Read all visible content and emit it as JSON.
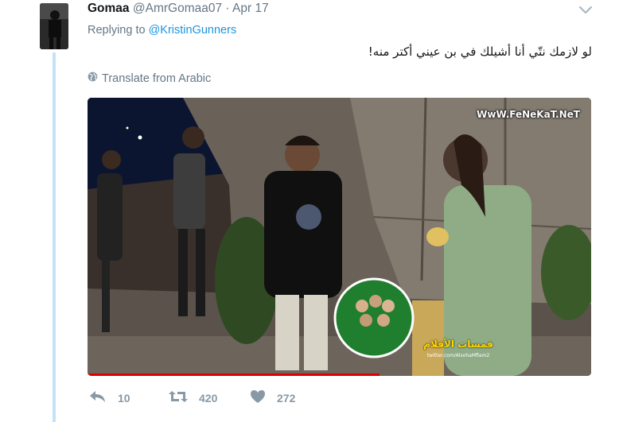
{
  "tweet": {
    "name": "Gomaa",
    "handle": "@AmrGomaa07",
    "separator": "·",
    "date": "Apr 17",
    "replying_prefix": "Replying to",
    "replying_to": "@KristinGunners",
    "text": "لو لازمك نتّي أنا أشيلك في بن عيني أكتر منه!",
    "translate_label": "Translate from Arabic"
  },
  "media": {
    "watermark": "WwW.FeNeKaT.NeT",
    "badge_text": "فمسات الأفلام",
    "badge_subtext": "twitter.com/AlsohaMflam2",
    "progress_fraction": 0.58
  },
  "actions": {
    "replies": "10",
    "retweets": "420",
    "likes": "272"
  },
  "icons": {
    "caret": "chevron-down-icon",
    "globe": "globe-icon",
    "reply": "reply-icon",
    "retweet": "retweet-icon",
    "like": "heart-icon"
  },
  "colors": {
    "accent": "#1b95e0",
    "muted": "#657786",
    "thread_line": "#c4e2f6",
    "action_gray": "#8899a6"
  }
}
